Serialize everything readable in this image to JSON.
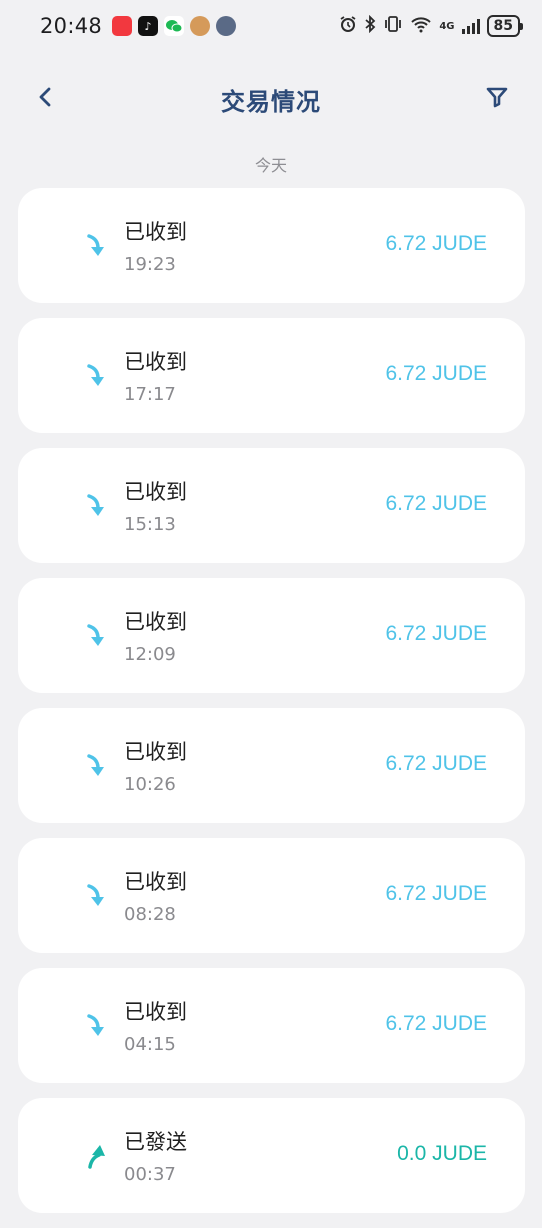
{
  "status_bar": {
    "time": "20:48",
    "battery": "85",
    "network": "4G"
  },
  "header": {
    "title": "交易情况"
  },
  "section": {
    "date_label": "今天"
  },
  "transactions": [
    {
      "type": "已收到",
      "time": "19:23",
      "amount": "6.72 JUDE",
      "direction": "received"
    },
    {
      "type": "已收到",
      "time": "17:17",
      "amount": "6.72 JUDE",
      "direction": "received"
    },
    {
      "type": "已收到",
      "time": "15:13",
      "amount": "6.72 JUDE",
      "direction": "received"
    },
    {
      "type": "已收到",
      "time": "12:09",
      "amount": "6.72 JUDE",
      "direction": "received"
    },
    {
      "type": "已收到",
      "time": "10:26",
      "amount": "6.72 JUDE",
      "direction": "received"
    },
    {
      "type": "已收到",
      "time": "08:28",
      "amount": "6.72 JUDE",
      "direction": "received"
    },
    {
      "type": "已收到",
      "time": "04:15",
      "amount": "6.72 JUDE",
      "direction": "received"
    },
    {
      "type": "已發送",
      "time": "00:37",
      "amount": "0.0 JUDE",
      "direction": "sent"
    }
  ],
  "colors": {
    "title": "#2c4a78",
    "received": "#4fc3e8",
    "sent": "#1bb6a8",
    "background": "#f1f1f3"
  }
}
